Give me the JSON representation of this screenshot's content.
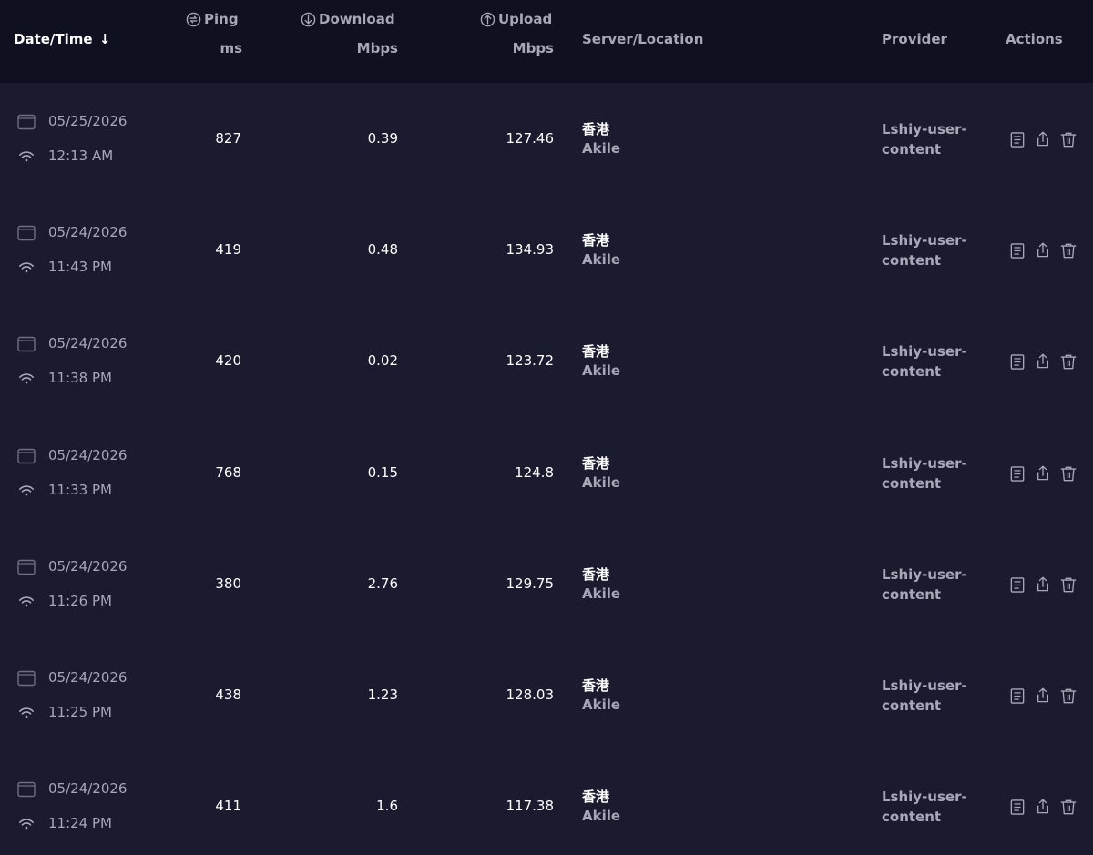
{
  "header": {
    "datetime_label": "Date/Time",
    "sort_arrow": "↓",
    "ping_label": "Ping",
    "ping_unit": "ms",
    "download_label": "Download",
    "download_unit": "Mbps",
    "upload_label": "Upload",
    "upload_unit": "Mbps",
    "server_label": "Server/Location",
    "provider_label": "Provider",
    "actions_label": "Actions",
    "icons": {
      "ping": "ping-icon",
      "download": "download-icon",
      "upload": "upload-icon"
    }
  },
  "rows": [
    {
      "date": "05/25/2026",
      "time": "12:13 AM",
      "ping": "827",
      "download": "0.39",
      "upload": "127.46",
      "server": "香港",
      "location": "Akile",
      "provider_line1": "Lshiy-user-",
      "provider_line2": "content"
    },
    {
      "date": "05/24/2026",
      "time": "11:43 PM",
      "ping": "419",
      "download": "0.48",
      "upload": "134.93",
      "server": "香港",
      "location": "Akile",
      "provider_line1": "Lshiy-user-",
      "provider_line2": "content"
    },
    {
      "date": "05/24/2026",
      "time": "11:38 PM",
      "ping": "420",
      "download": "0.02",
      "upload": "123.72",
      "server": "香港",
      "location": "Akile",
      "provider_line1": "Lshiy-user-",
      "provider_line2": "content"
    },
    {
      "date": "05/24/2026",
      "time": "11:33 PM",
      "ping": "768",
      "download": "0.15",
      "upload": "124.8",
      "server": "香港",
      "location": "Akile",
      "provider_line1": "Lshiy-user-",
      "provider_line2": "content"
    },
    {
      "date": "05/24/2026",
      "time": "11:26 PM",
      "ping": "380",
      "download": "2.76",
      "upload": "129.75",
      "server": "香港",
      "location": "Akile",
      "provider_line1": "Lshiy-user-",
      "provider_line2": "content"
    },
    {
      "date": "05/24/2026",
      "time": "11:25 PM",
      "ping": "438",
      "download": "1.23",
      "upload": "128.03",
      "server": "香港",
      "location": "Akile",
      "provider_line1": "Lshiy-user-",
      "provider_line2": "content"
    },
    {
      "date": "05/24/2026",
      "time": "11:24 PM",
      "ping": "411",
      "download": "1.6",
      "upload": "117.38",
      "server": "香港",
      "location": "Akile",
      "provider_line1": "Lshiy-user-",
      "provider_line2": "content"
    }
  ],
  "row_icons": [
    "calendar-icon",
    "wifi-icon",
    "report-icon",
    "share-icon",
    "trash-icon"
  ],
  "colors": {
    "background": "#1a1b2e",
    "header_bg": "#0f1020",
    "muted_text": "#a6a8b8",
    "text": "#ffffff"
  }
}
